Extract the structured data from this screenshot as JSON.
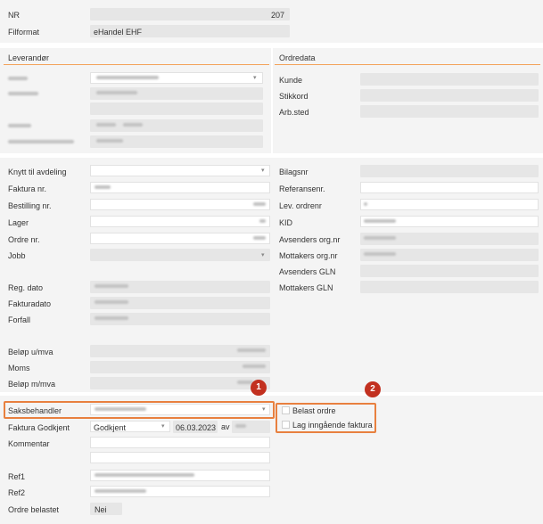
{
  "top": {
    "nr_label": "NR",
    "nr_value": "207",
    "filformat_label": "Filformat",
    "filformat_value": "eHandel EHF"
  },
  "leverandor": {
    "title": "Leverandør"
  },
  "ordredata": {
    "title": "Ordredata",
    "kunde": "Kunde",
    "stikkord": "Stikkord",
    "arbsted": "Arb.sted"
  },
  "left_fields": {
    "knytt": "Knytt til avdeling",
    "faktura_nr": "Faktura nr.",
    "bestilling_nr": "Bestilling nr.",
    "lager": "Lager",
    "ordre_nr": "Ordre nr.",
    "jobb": "Jobb",
    "reg_dato": "Reg. dato",
    "fakturadato": "Fakturadato",
    "forfall": "Forfall",
    "belop_umva": "Beløp u/mva",
    "moms": "Moms",
    "belop_mmva": "Beløp m/mva"
  },
  "right_fields": {
    "bilagsnr": "Bilagsnr",
    "referansenr": "Referansenr.",
    "lev_ordrenr": "Lev. ordrenr",
    "kid": "KID",
    "avsenders_org": "Avsenders org.nr",
    "mottakers_org": "Mottakers org.nr",
    "avsenders_gln": "Avsenders GLN",
    "mottakers_gln": "Mottakers GLN"
  },
  "bottom": {
    "saksbehandler": "Saksbehandler",
    "faktura_godkjent": "Faktura Godkjent",
    "godkjent_value": "Godkjent",
    "godkjent_date": "06.03.2023",
    "av": "av",
    "kommentar": "Kommentar",
    "ref1": "Ref1",
    "ref2": "Ref2",
    "ordre_belastet": "Ordre belastet",
    "ordre_belastet_value": "Nei",
    "belast_ordre": "Belast ordre",
    "lag_inngaende": "Lag inngående faktura"
  },
  "badges": {
    "one": "1",
    "two": "2"
  },
  "colors": {
    "accent": "#f3a25a",
    "highlight": "#e8803f",
    "badge": "#c2301f"
  }
}
